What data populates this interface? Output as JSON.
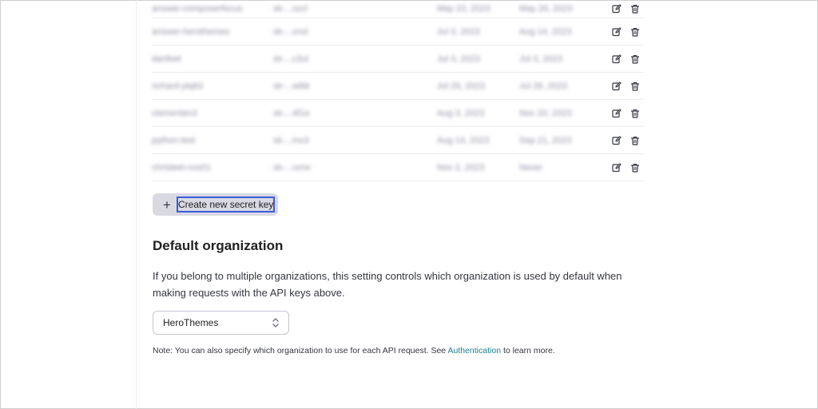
{
  "keys": [
    {
      "name": "answer-composerfocus",
      "key": "sk-...xzcl",
      "created": "May 23, 2023",
      "last_used": "May 26, 2023"
    },
    {
      "name": "answer-herothemes",
      "key": "sk-...xnxl",
      "created": "Jul 3, 2023",
      "last_used": "Aug 14, 2023"
    },
    {
      "name": "danfeet",
      "key": "sk-...c3ul",
      "created": "Jul 3, 2023",
      "last_used": "Jul 3, 2023"
    },
    {
      "name": "richard-ytqtt3",
      "key": "sk-...wibk",
      "created": "Jul 26, 2023",
      "last_used": "Jul 26, 2023"
    },
    {
      "name": "clementen3",
      "key": "sk-...4f1a",
      "created": "Aug 3, 2023",
      "last_used": "Nov 20, 2023"
    },
    {
      "name": "python-test",
      "key": "sk-...mx3",
      "created": "Aug 14, 2023",
      "last_used": "Sep 21, 2023"
    },
    {
      "name": "chrisleet-nxs01",
      "key": "sk-...xxrw",
      "created": "Nov 2, 2023",
      "last_used": "Never"
    }
  ],
  "create_button": {
    "label": "Create new secret key",
    "icon": "plus-icon"
  },
  "default_org": {
    "title": "Default organization",
    "description": "If you belong to multiple organizations, this setting controls which organization is used by default when making requests with the API keys above.",
    "selected": "HeroThemes"
  },
  "note": {
    "prefix": "Note: You can also specify which organization to use for each API request. See ",
    "link": "Authentication",
    "suffix": " to learn more."
  },
  "colors": {
    "accent_link": "#1a7f8f",
    "button_bg": "#d9d9e3",
    "focus_ring": "#3b5bdb"
  }
}
